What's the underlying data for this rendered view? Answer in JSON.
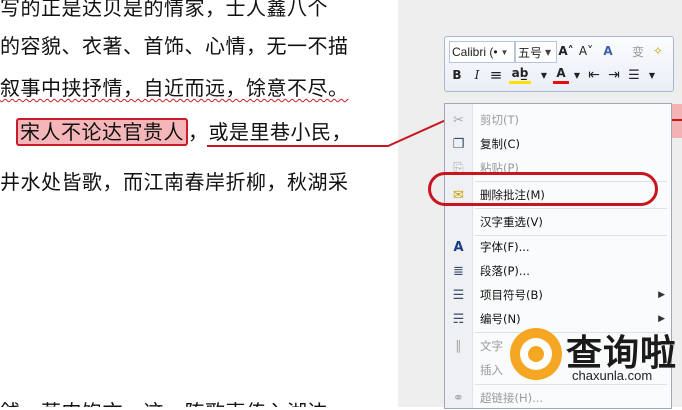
{
  "document": {
    "lines": [
      "写的正是达贝是的情家，士人鑫八个",
      "的容貌、衣著、首饰、心情，无一不描",
      "叙事中挟抒情，自近而远，馀意不尽。",
      "宋人不论达官贵人",
      "，或是里巷小民，",
      "井水处皆歌，而江南春岸折柳，秋湖采",
      "銭，蒸肉饱文，这一阵歌声传入湖边一"
    ]
  },
  "mini_toolbar": {
    "font_name": "Calibri (•",
    "font_size": "五号",
    "grow_font_icon": "A˄",
    "shrink_font_icon": "A˅",
    "style_icon": "A",
    "phonetic_icon": "变",
    "format_painter_icon": "✧",
    "bold": "B",
    "italic": "I",
    "center_icon": "≡",
    "highlight_icon": "ab̲",
    "font_color_icon": "A",
    "decrease_indent_icon": "⇤",
    "increase_indent_icon": "⇥",
    "bullets_icon": "☰"
  },
  "context_menu": {
    "items": [
      {
        "label": "剪切(T)",
        "icon": "✂",
        "disabled": true
      },
      {
        "label": "复制(C)",
        "icon": "❐",
        "disabled": false
      },
      {
        "label": "粘贴(P)",
        "icon": "⎘",
        "disabled": true
      },
      {
        "label": "删除批注(M)",
        "icon": "✉",
        "disabled": false
      },
      {
        "label": "汉字重选(V)",
        "icon": "",
        "disabled": false
      },
      {
        "label": "字体(F)...",
        "icon": "A",
        "disabled": false
      },
      {
        "label": "段落(P)...",
        "icon": "≣",
        "disabled": false
      },
      {
        "label": "项目符号(B)",
        "icon": "☰",
        "disabled": false,
        "submenu": true
      },
      {
        "label": "编号(N)",
        "icon": "☴",
        "disabled": false,
        "submenu": true
      },
      {
        "label": "文字",
        "icon": "∥",
        "disabled": true
      },
      {
        "label": "插入",
        "icon": "",
        "disabled": true
      },
      {
        "label": "超链接(H)...",
        "icon": "⚭",
        "disabled": true
      }
    ]
  },
  "watermark": {
    "name": "查询啦",
    "domain": "chaxunla.com"
  },
  "colors": {
    "highlight": "#f4b6b8",
    "annotation_red": "#c9151f",
    "watermark_orange": "#f5a623"
  }
}
